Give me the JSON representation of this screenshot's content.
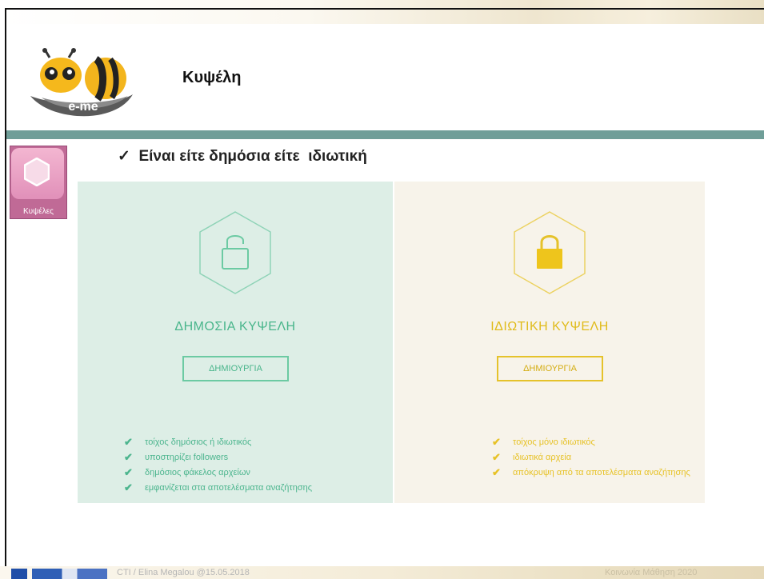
{
  "header": {
    "title": "Κυψέλη",
    "logo_text": "e-me"
  },
  "sidebar": {
    "app_label": "Κυψέλες"
  },
  "bullet_text": "✓  Είναι είτε δημόσια είτε  ιδιωτική",
  "panels": {
    "public": {
      "title": "ΔΗΜΟΣΙΑ ΚΥΨΕΛΗ",
      "button": "ΔΗΜΙΟΥΡΓΙΑ",
      "features": [
        "τοίχος δημόσιος ή ιδιωτικός",
        "υποστηρίζει followers",
        "δημόσιος φάκελος αρχείων",
        "εμφανίζεται στα αποτελέσματα αναζήτησης"
      ],
      "color": "#49b58b"
    },
    "private": {
      "title": "ΙΔΙΩΤΙΚΗ ΚΥΨΕΛΗ",
      "button": "ΔΗΜΙΟΥΡΓΙΑ",
      "features": [
        "τοίχος μόνο ιδιωτικός",
        "ιδιωτικά αρχεία",
        "απόκρυψη από τα αποτελέσματα αναζήτησης"
      ],
      "color": "#e0bb1a"
    }
  },
  "footer": {
    "credit": "CTI / Elina Megalou @15.05.2018",
    "right_text": "Κοινωνία Μάθηση 2020"
  },
  "icons": {
    "check": "✔",
    "public_lock": "unlocked-padlock-icon",
    "private_lock": "locked-padlock-icon"
  }
}
